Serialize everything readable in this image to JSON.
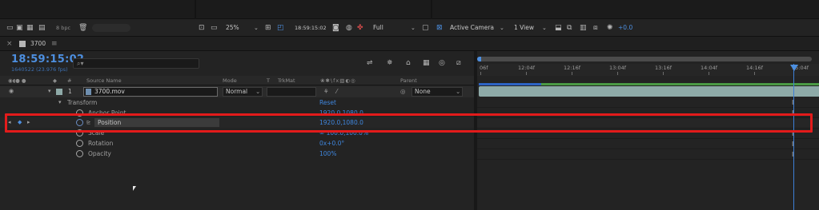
{
  "project_bar": {
    "bpc": "8 bpc"
  },
  "viewer": {
    "zoom": "25%",
    "timecode": "18:59:15:02",
    "resolution": "Full",
    "camera": "Active Camera",
    "view": "1 View",
    "exposure": "+0.0"
  },
  "comp_tab": {
    "name": "3700"
  },
  "timeline": {
    "current_time": "18:59:15:02",
    "fps_readout": "1640522 (23.976 fps)",
    "search_placeholder": "⌕▾"
  },
  "columns": {
    "num": "#",
    "source_name": "Source Name",
    "mode": "Mode",
    "t": "T",
    "trkmat": "TrkMat",
    "switches": "❀✱\\fx▧◐◎",
    "parent": "Parent"
  },
  "layer": {
    "number": "1",
    "name": "3700.mov",
    "mode": "Normal",
    "parent": "None"
  },
  "transform": {
    "label": "Transform",
    "reset": "Reset"
  },
  "properties": [
    {
      "name": "Anchor Point",
      "value": "1920.0,1080.0"
    },
    {
      "name": "Position",
      "value": "1920.0,1080.0"
    },
    {
      "name": "Scale",
      "value": "∞ 100.0,100.0%"
    },
    {
      "name": "Rotation",
      "value": "0x+0.0°"
    },
    {
      "name": "Opacity",
      "value": "100%"
    }
  ],
  "ruler": {
    "labels": [
      "06f",
      "12:04f",
      "12:16f",
      "13:04f",
      "13:16f",
      "14:04f",
      "14:16f",
      "15:04f"
    ]
  },
  "colors": {
    "accent_blue": "#3f86dd",
    "highlight_red": "#e31b1b",
    "layer_bar": "#8eaaa8",
    "work_area": "#4a9a45"
  }
}
